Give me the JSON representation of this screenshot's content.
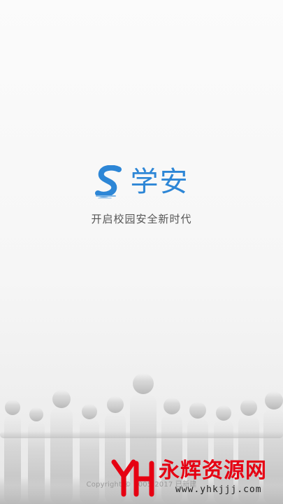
{
  "brand": {
    "name": "学安",
    "tagline": "开启校园安全新时代",
    "logo_icon": "s-logo-icon",
    "accent_color": "#2d86d6"
  },
  "footer": {
    "copyright": "Copyright © 2005-2017 已新建"
  },
  "watermark": {
    "text": "永辉资源网",
    "url": "www.yhkjjj.com",
    "color": "#e60012"
  }
}
